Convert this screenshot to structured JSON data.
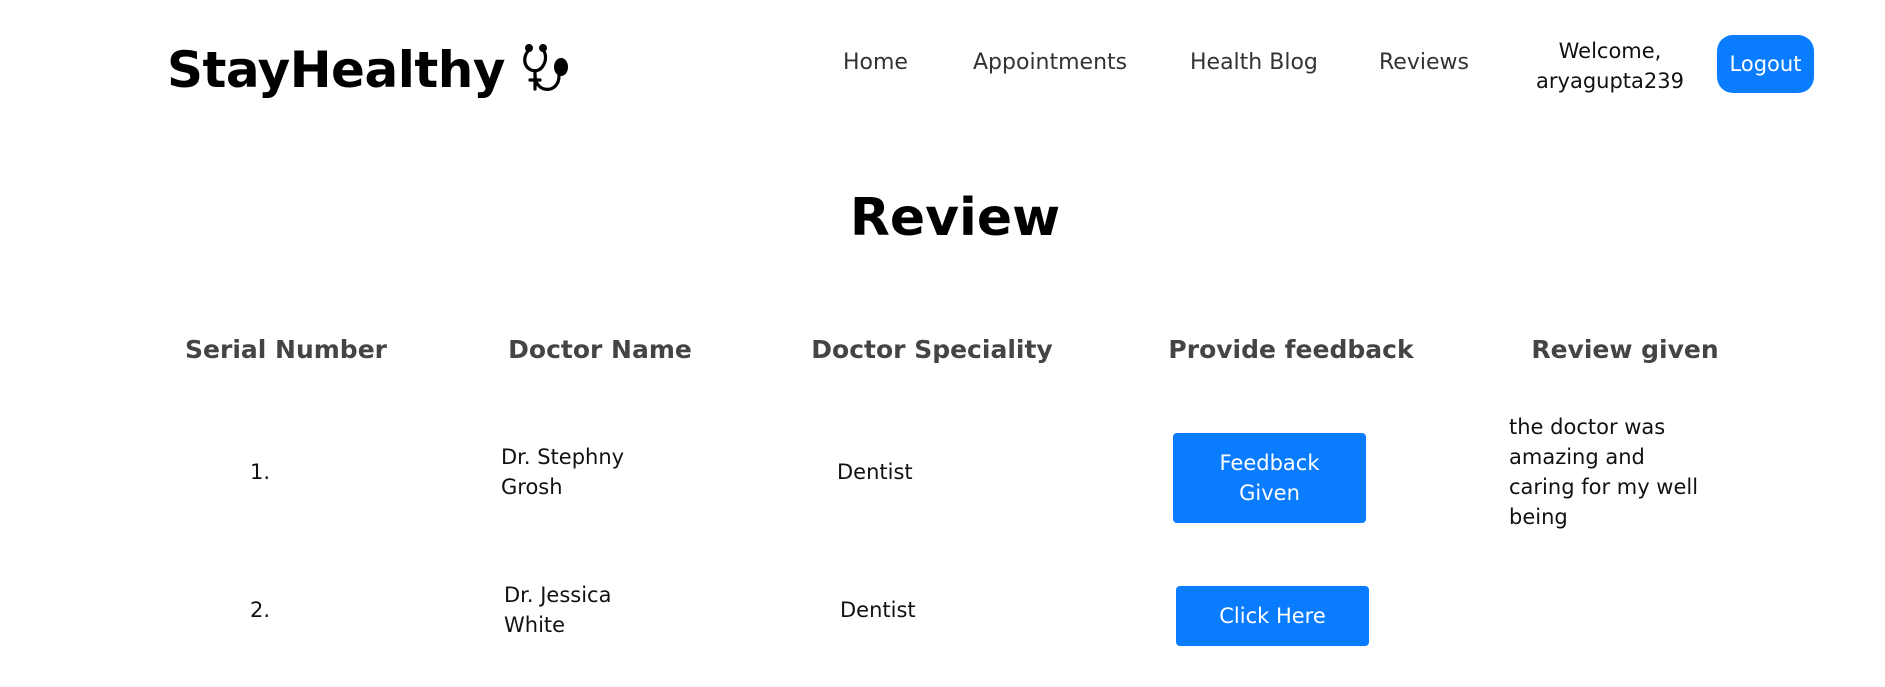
{
  "nav": {
    "brand": "StayHealthy",
    "brand_icon": "stethoscope-icon",
    "links": [
      "Home",
      "Appointments",
      "Health Blog",
      "Reviews"
    ],
    "welcome_line1": "Welcome,",
    "welcome_line2": "aryagupta239",
    "logout_label": "Logout"
  },
  "page": {
    "title": "Review"
  },
  "table": {
    "headers": [
      "Serial Number",
      "Doctor Name",
      "Doctor Speciality",
      "Provide feedback",
      "Review given"
    ],
    "rows": [
      {
        "serial": "1.",
        "doctor_line1": "Dr. Stephny",
        "doctor_line2": "Grosh",
        "speciality": "Dentist",
        "feedback_line1": "Feedback",
        "feedback_line2": "Given",
        "review": "the doctor was amazing and caring for my well being"
      },
      {
        "serial": "2.",
        "doctor_line1": "Dr. Jessica",
        "doctor_line2": "White",
        "speciality": "Dentist",
        "feedback_label": "Click Here",
        "review": ""
      }
    ]
  },
  "colors": {
    "accent": "#0a7cff",
    "header_text": "#444444"
  }
}
